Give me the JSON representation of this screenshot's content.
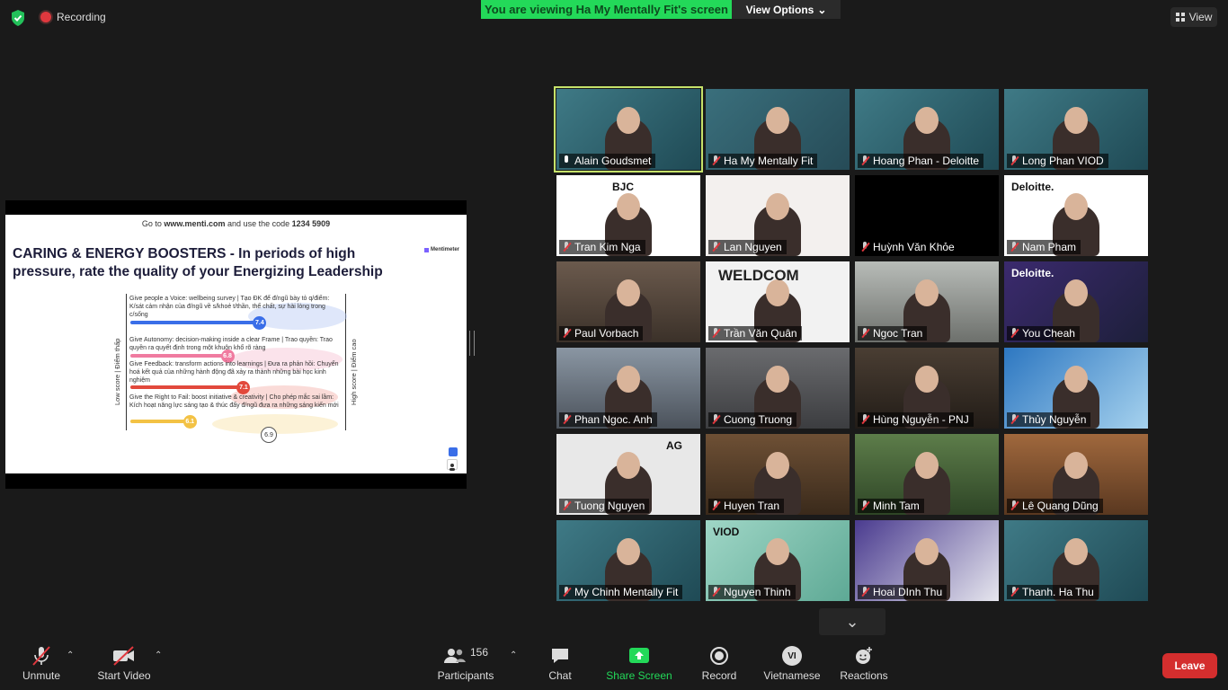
{
  "topbar": {
    "recording": "Recording",
    "banner": "You are viewing Ha My Mentally Fit's screen",
    "view_options": "View Options",
    "view": "View"
  },
  "slide": {
    "code_prefix": "Go to",
    "code_url": "www.menti.com",
    "code_mid": "and use the code",
    "code": "1234 5909",
    "title": "CARING & ENERGY BOOSTERS - In periods of high pressure, rate the quality of your Energizing Leadership",
    "brand": "Mentimeter",
    "low_label": "Low score | Điểm thấp",
    "high_label": "High score | Điểm cao",
    "items": [
      {
        "text": "Give people a Voice: wellbeing survey | Tạo ĐK để đ/ngũ bày tỏ q/điểm: K/sát cảm nhận của đ/ngũ về s/khoẻ t/thần, thể chất, sự hài lòng trong c/sống",
        "score": "7.4",
        "value": 7.4,
        "color": "#3a6ee8"
      },
      {
        "text": "Give Autonomy: decision-making inside a clear Frame | Trao quyền: Trao quyền ra quyết định trong một khuôn khổ rõ ràng",
        "score": "6.8",
        "value": 6.8,
        "color": "#f07ba0"
      },
      {
        "text": "Give Feedback: transform actions into learnings | Đưa ra phản hồi: Chuyển hoá kết quả của những hành động đã xảy ra thành những bài học kinh nghiệm",
        "score": "7.1",
        "value": 7.1,
        "color": "#e2493c"
      },
      {
        "text": "Give the Right to Fail: boost initiative & creativity | Cho phép mắc sai lầm: Kích hoạt năng lực sáng tạo & thúc đẩy đ/ngũ đưa ra những sáng kiến mới",
        "score": "6.1",
        "value": 6.1,
        "color": "#f3c245"
      }
    ],
    "average": "6.9"
  },
  "participants_tiles": [
    {
      "name": "Alain Goudsmet",
      "active": true,
      "pinned": true
    },
    {
      "name": "Ha My Mentally Fit"
    },
    {
      "name": "Hoang Phan - Deloitte"
    },
    {
      "name": "Long Phan VIOD"
    },
    {
      "name": "Tran Kim Nga",
      "logo": "BJC"
    },
    {
      "name": "Lan Nguyen"
    },
    {
      "name": "Huỳnh Văn Khỏe",
      "video_off": true
    },
    {
      "name": "Nam Pham",
      "logo": "Deloitte."
    },
    {
      "name": "Paul Vorbach"
    },
    {
      "name": "Trần Văn Quân",
      "logo": "WELDCOM"
    },
    {
      "name": "Ngoc Tran"
    },
    {
      "name": "You Cheah",
      "logo": "Deloitte."
    },
    {
      "name": "Phan Ngoc. Anh"
    },
    {
      "name": "Cuong Truong"
    },
    {
      "name": "Hùng Nguyễn - PNJ"
    },
    {
      "name": "Thủy Nguyễn"
    },
    {
      "name": "Tuong Nguyen",
      "logo": "AG"
    },
    {
      "name": "Huyen Tran"
    },
    {
      "name": "Minh Tam"
    },
    {
      "name": "Lê Quang Dũng"
    },
    {
      "name": "My Chinh Mentally Fit"
    },
    {
      "name": "Nguyen Thinh",
      "logo": "VIOD"
    },
    {
      "name": "Hoai DInh Thu"
    },
    {
      "name": "Thanh. Ha Thu"
    }
  ],
  "toolbar": {
    "unmute": "Unmute",
    "start_video": "Start Video",
    "participants": "Participants",
    "participant_count": "156",
    "chat": "Chat",
    "share_screen": "Share Screen",
    "record": "Record",
    "language": "Vietnamese",
    "language_badge": "VI",
    "reactions": "Reactions",
    "leave": "Leave"
  },
  "colors": {
    "banner_bg": "#23d959",
    "share_green": "#23d959",
    "leave_red": "#d42e2e",
    "active_border": "#c6e26a"
  }
}
